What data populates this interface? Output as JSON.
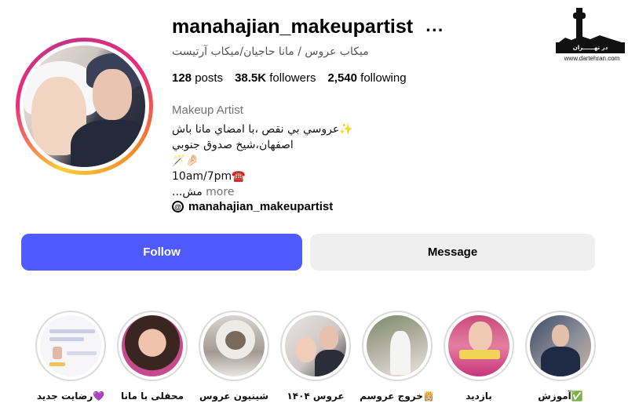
{
  "profile": {
    "username": "manahajian_makeupartist",
    "more_options": "...",
    "full_name": "میکاب عروس / مانا حاجیان/میکاب آرتیست",
    "stats": {
      "posts_value": "128",
      "posts_label": "posts",
      "followers_value": "38.5K",
      "followers_label": "followers",
      "following_value": "2,540",
      "following_label": "following"
    },
    "category": "Makeup Artist",
    "bio": {
      "line1": "عروسي بي نقص ،با امضاي مانا باش✨",
      "line2": "اصفهان،شيخ صدوق جنوبي",
      "line3": "🪄🤌🏻",
      "line4": "10am/7pm☎️",
      "line5_text": "...مش",
      "line5_more": "more"
    },
    "threads_handle": "manahajian_makeupartist",
    "threads_icon": "@"
  },
  "logo": {
    "band_text": "در تهــــــران",
    "url": "www.dartehran.com"
  },
  "actions": {
    "follow_label": "Follow",
    "message_label": "Message"
  },
  "highlights": [
    {
      "label": "آموزش✅",
      "icon": "highlight-thumbnail"
    },
    {
      "label": "بازدید",
      "icon": "highlight-thumbnail"
    },
    {
      "label": "خروج عروسم👸🏼",
      "icon": "highlight-thumbnail"
    },
    {
      "label": "عروس ۱۴۰۴",
      "icon": "highlight-thumbnail"
    },
    {
      "label": "شینیون عروس",
      "icon": "highlight-thumbnail"
    },
    {
      "label": "محفلی با مانا",
      "icon": "highlight-thumbnail"
    },
    {
      "label": "رضایت جدید💜",
      "icon": "highlight-thumbnail"
    }
  ],
  "colors": {
    "follow_button": "#4f5bff",
    "message_button": "#efefef",
    "secondary_text": "#737373"
  }
}
